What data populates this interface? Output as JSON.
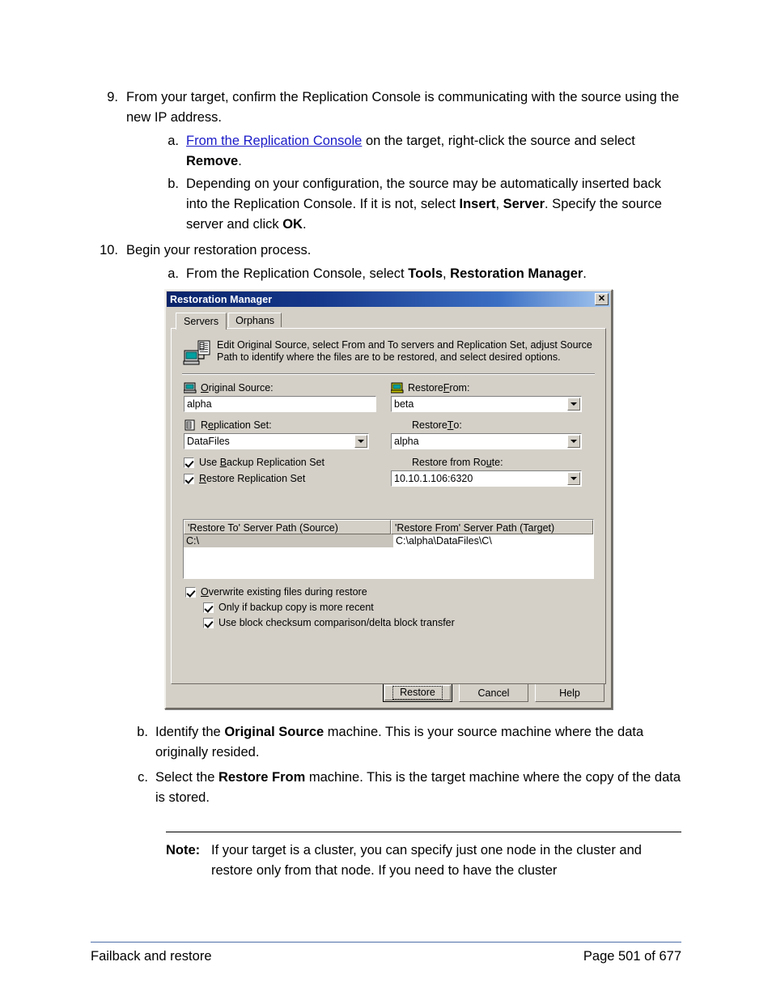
{
  "document": {
    "steps": [
      {
        "num": "9.",
        "text_parts": [
          {
            "t": "From your target, confirm the Replication Console is communicating with the source using the new IP address."
          }
        ],
        "substeps": [
          {
            "num": "a.",
            "parts": [
              {
                "t": "From the Replication Console",
                "style": "link"
              },
              {
                "t": " on the target, right-click the source and select "
              },
              {
                "t": "Remove",
                "style": "bold"
              },
              {
                "t": "."
              }
            ]
          },
          {
            "num": "b.",
            "parts": [
              {
                "t": "Depending on your configuration, the source may be automatically inserted back into the Replication Console. If it is not, select "
              },
              {
                "t": "Insert",
                "style": "bold"
              },
              {
                "t": ", "
              },
              {
                "t": "Server",
                "style": "bold"
              },
              {
                "t": ". Specify the source server and click "
              },
              {
                "t": "OK",
                "style": "bold"
              },
              {
                "t": "."
              }
            ]
          }
        ]
      },
      {
        "num": "10.",
        "text_parts": [
          {
            "t": "Begin your restoration process."
          }
        ],
        "substeps": [
          {
            "num": "a.",
            "parts": [
              {
                "t": "From the Replication Console, select "
              },
              {
                "t": "Tools",
                "style": "bold"
              },
              {
                "t": ", "
              },
              {
                "t": "Restoration Manager",
                "style": "bold"
              },
              {
                "t": "."
              }
            ]
          }
        ]
      }
    ],
    "tail_substeps": [
      {
        "num": "b.",
        "parts": [
          {
            "t": "Identify the "
          },
          {
            "t": "Original Source",
            "style": "bold"
          },
          {
            "t": " machine. This is your source machine where the data originally resided."
          }
        ]
      },
      {
        "num": "c.",
        "parts": [
          {
            "t": "Select the "
          },
          {
            "t": "Restore From",
            "style": "bold"
          },
          {
            "t": " machine. This is the target machine where the copy of the data is stored."
          }
        ]
      }
    ],
    "note": {
      "label": "Note:",
      "text": "If your target is a cluster, you can specify just one node in the cluster and restore only from that node. If you need to have the cluster"
    },
    "footer": {
      "left": "Failback and restore",
      "right": "Page 501 of 677"
    }
  },
  "dialog": {
    "title": "Restoration Manager",
    "close_label": "✕",
    "tabs": [
      {
        "label": "Servers",
        "active": true
      },
      {
        "label": "Orphans",
        "active": false
      }
    ],
    "description": "Edit Original Source, select From and To servers and Replication Set, adjust Source Path to identify where the files are to be restored, and select desired options.",
    "fields": {
      "original_source": {
        "label_pre": "",
        "label_accel": "O",
        "label_post": "riginal Source:",
        "value": "alpha"
      },
      "replication_set": {
        "label_pre": "R",
        "label_accel": "e",
        "label_post": "plication Set:",
        "value": "DataFiles"
      },
      "restore_from": {
        "label_pre": "Restore ",
        "label_accel": "F",
        "label_post": "rom:",
        "value": "beta"
      },
      "restore_to": {
        "label_pre": "Restore ",
        "label_accel": "T",
        "label_post": "o:",
        "value": "alpha"
      },
      "restore_from_route": {
        "label_pre": "Restore from Ro",
        "label_accel": "u",
        "label_post": "te:",
        "value": "10.10.1.106:6320"
      }
    },
    "checkboxes": {
      "use_backup_replication_set": {
        "pre": "Use ",
        "accel": "B",
        "post": "ackup Replication Set",
        "checked": true
      },
      "restore_replication_set": {
        "pre": "",
        "accel": "R",
        "post": "estore Replication Set",
        "checked": true
      },
      "overwrite_existing": {
        "pre": "",
        "accel": "O",
        "post": "verwrite existing files during restore",
        "checked": true
      },
      "only_if_more_recent": {
        "pre": "Only if backup copy is more recent",
        "accel": "",
        "post": "",
        "checked": true
      },
      "use_block_checksum": {
        "pre": "Use block checksum comparison/delta block transfer",
        "accel": "",
        "post": "",
        "checked": true
      }
    },
    "listview": {
      "columns": [
        "'Restore To' Server Path (Source)",
        "'Restore From' Server Path (Target)"
      ],
      "rows": [
        {
          "source": "C:\\",
          "target": "C:\\alpha\\DataFiles\\C\\",
          "selected": true
        }
      ]
    },
    "buttons": {
      "restore": "Restore",
      "cancel": "Cancel",
      "help": "Help"
    }
  }
}
